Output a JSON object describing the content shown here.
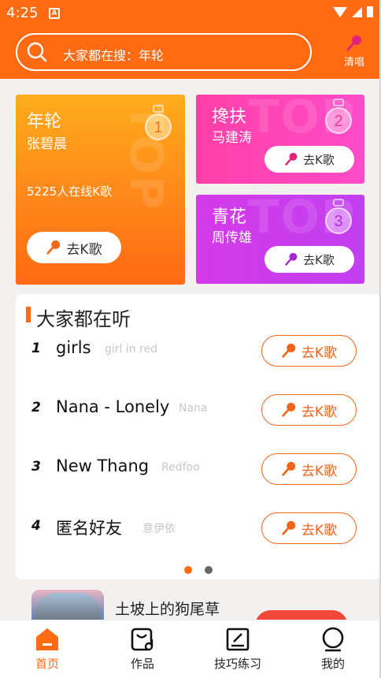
{
  "status_bar": {
    "time": "4:25"
  },
  "header": {
    "search_placeholder": "大家都在搜：年轮",
    "qingchang_label": "清唱"
  },
  "top_cards": [
    {
      "rank": "1",
      "song": "年轮",
      "artist": "张碧晨",
      "online_text": "5225人在线K歌",
      "button_label": "去K歌"
    },
    {
      "rank": "2",
      "song": "搀扶",
      "artist": "马建涛",
      "button_label": "去K歌"
    },
    {
      "rank": "3",
      "song": "青花",
      "artist": "周传雄",
      "button_label": "去K歌"
    }
  ],
  "card_watermark": "TOP",
  "listening": {
    "title": "大家都在听",
    "items": [
      {
        "num": "1",
        "name": "girls",
        "singer": "girl in red",
        "button_label": "去K歌"
      },
      {
        "num": "2",
        "name": "Nana - Lonely",
        "singer": "Nana",
        "button_label": "去K歌"
      },
      {
        "num": "3",
        "name": "New Thang",
        "singer": "Redfoo",
        "button_label": "去K歌"
      },
      {
        "num": "4",
        "name": "匿名好友",
        "singer": "意伊依",
        "button_label": "去K歌"
      }
    ],
    "page_dots": {
      "count": 2,
      "active": 0
    }
  },
  "next_item": {
    "title": "土坡上的狗尾草"
  },
  "bottom_nav": [
    {
      "label": "首页",
      "icon": "home-icon",
      "active": true
    },
    {
      "label": "作品",
      "icon": "works-icon",
      "active": false
    },
    {
      "label": "技巧练习",
      "icon": "practice-icon",
      "active": false
    },
    {
      "label": "我的",
      "icon": "profile-icon",
      "active": false
    }
  ],
  "colors": {
    "brand": "#ff6a12",
    "card2": "#ff44b4",
    "card3": "#c63ff0",
    "button_accent": "#f0651a"
  }
}
